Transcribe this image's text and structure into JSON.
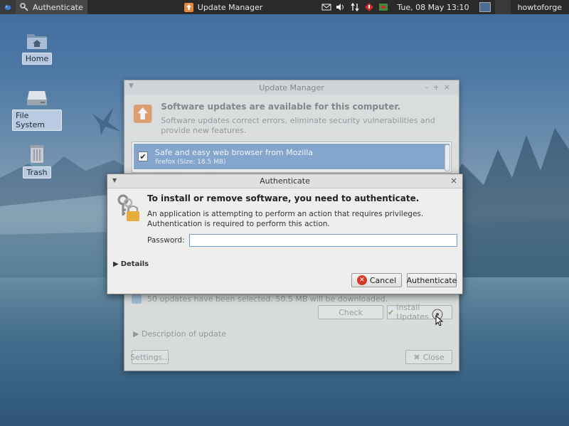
{
  "panel": {
    "window_tabs": [
      {
        "label": "Authenticate",
        "active": true
      },
      {
        "label": "Update Manager",
        "active": false
      }
    ],
    "clock": "Tue, 08 May  13:10",
    "user": "howtoforge"
  },
  "desktop": {
    "icons": [
      {
        "label": "Home"
      },
      {
        "label": "File System"
      },
      {
        "label": "Trash"
      }
    ]
  },
  "update_manager": {
    "title": "Update Manager",
    "heading": "Software updates are available for this computer.",
    "subtext": "Software updates correct errors, eliminate security vulnerabilities and provide new features.",
    "updates": [
      {
        "title": "Safe and easy web browser from Mozilla",
        "detail": "firefox (Size: 18.5 MB)",
        "checked": true
      }
    ],
    "status": "50 updates have been selected. 50.5 MB will be downloaded.",
    "check_label": "Check",
    "install_label": "Install Updates",
    "description_label": "Description of update",
    "settings_label": "Settings...",
    "close_label": "Close"
  },
  "auth_dialog": {
    "title": "Authenticate",
    "heading": "To install or remove software, you need to authenticate.",
    "message": "An application is attempting to perform an action that requires privileges. Authentication is required to perform this action.",
    "password_label": "Password:",
    "password_value": "",
    "details_label": "Details",
    "cancel_label": "Cancel",
    "authenticate_label": "Authenticate"
  },
  "colors": {
    "panel": "#2a2a2a",
    "selection": "#86a7cf",
    "input_focus": "#6f9ad0",
    "cancel_icon": "#d43b2a"
  }
}
